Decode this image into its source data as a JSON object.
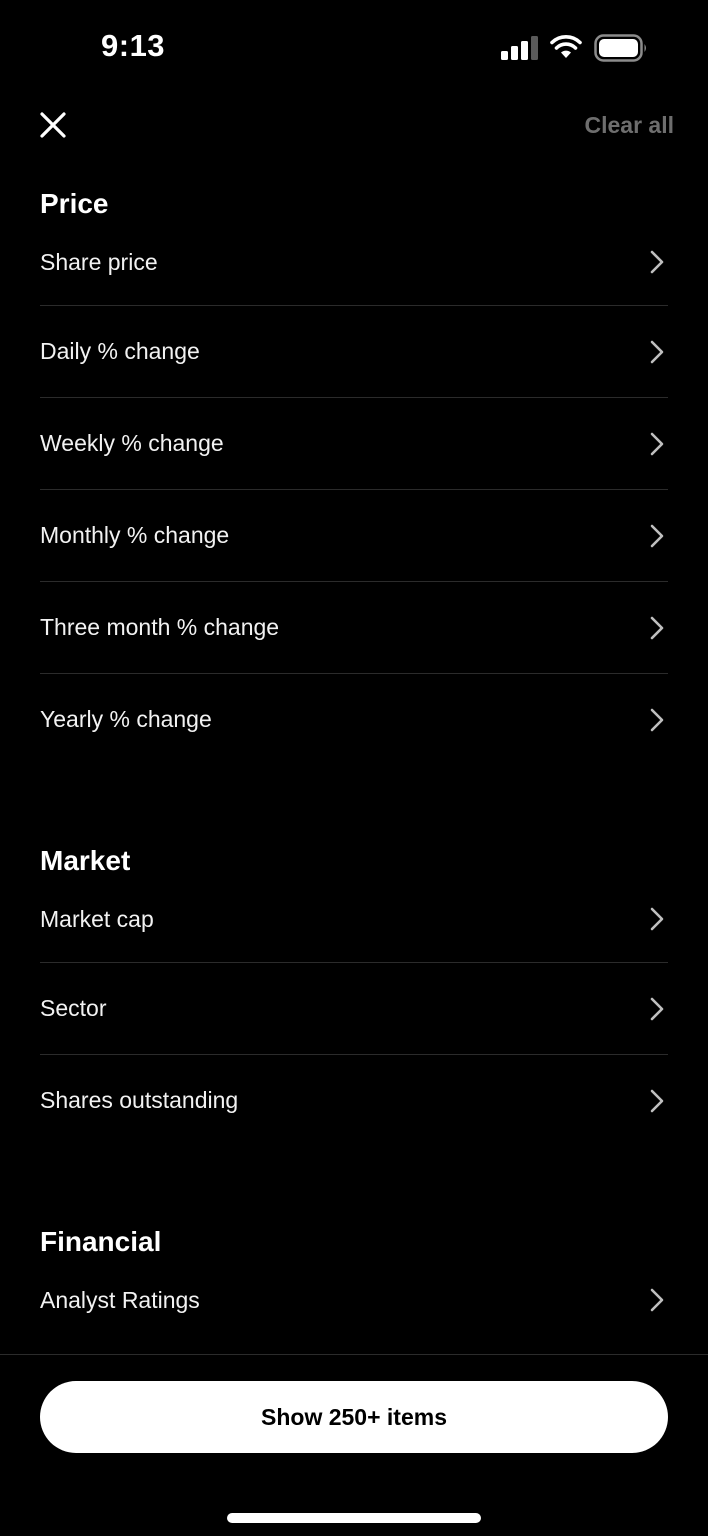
{
  "status_bar": {
    "time": "9:13"
  },
  "header": {
    "close_icon": "close-icon",
    "clear_all_label": "Clear all"
  },
  "sections": [
    {
      "title": "Price",
      "items": [
        {
          "label": "Share price"
        },
        {
          "label": "Daily % change"
        },
        {
          "label": "Weekly % change"
        },
        {
          "label": "Monthly % change"
        },
        {
          "label": "Three month % change"
        },
        {
          "label": "Yearly % change"
        }
      ]
    },
    {
      "title": "Market",
      "items": [
        {
          "label": "Market cap"
        },
        {
          "label": "Sector"
        },
        {
          "label": "Shares outstanding"
        }
      ]
    },
    {
      "title": "Financial",
      "items": [
        {
          "label": "Analyst Ratings"
        }
      ]
    }
  ],
  "footer": {
    "show_button_label": "Show 250+ items"
  },
  "colors": {
    "background": "#000000",
    "text": "#ffffff",
    "muted": "#6e6e6e",
    "divider": "#2b2b2b",
    "button_bg": "#ffffff",
    "button_text": "#000000"
  }
}
